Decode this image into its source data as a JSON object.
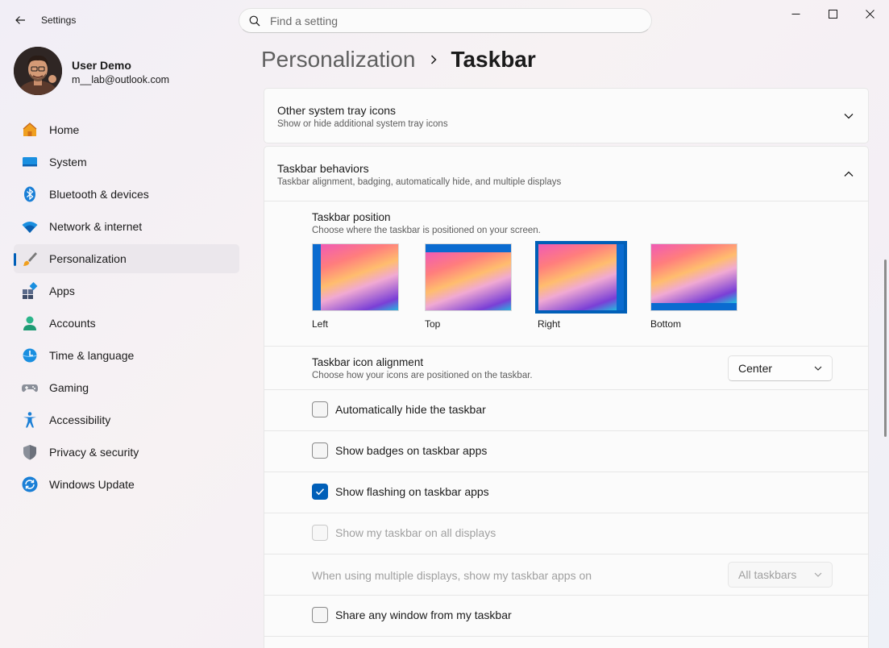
{
  "window": {
    "app_title": "Settings",
    "search_placeholder": "Find a setting"
  },
  "profile": {
    "name": "User Demo",
    "email": "m__lab@outlook.com"
  },
  "nav": {
    "items": [
      {
        "label": "Home",
        "icon": "home-icon"
      },
      {
        "label": "System",
        "icon": "system-icon"
      },
      {
        "label": "Bluetooth & devices",
        "icon": "bluetooth-icon"
      },
      {
        "label": "Network & internet",
        "icon": "wifi-icon"
      },
      {
        "label": "Personalization",
        "icon": "brush-icon",
        "active": true
      },
      {
        "label": "Apps",
        "icon": "apps-icon"
      },
      {
        "label": "Accounts",
        "icon": "accounts-icon"
      },
      {
        "label": "Time & language",
        "icon": "time-language-icon"
      },
      {
        "label": "Gaming",
        "icon": "gamepad-icon"
      },
      {
        "label": "Accessibility",
        "icon": "accessibility-icon"
      },
      {
        "label": "Privacy & security",
        "icon": "shield-icon"
      },
      {
        "label": "Windows Update",
        "icon": "update-icon"
      }
    ]
  },
  "breadcrumb": {
    "parent": "Personalization",
    "current": "Taskbar"
  },
  "tray_card": {
    "title": "Other system tray icons",
    "subtitle": "Show or hide additional system tray icons"
  },
  "behaviors_card": {
    "title": "Taskbar behaviors",
    "subtitle": "Taskbar alignment, badging, automatically hide, and multiple displays"
  },
  "position": {
    "title": "Taskbar position",
    "subtitle": "Choose where the taskbar is positioned on your screen.",
    "options": [
      "Left",
      "Top",
      "Right",
      "Bottom"
    ],
    "selected": "Right"
  },
  "alignment": {
    "title": "Taskbar icon alignment",
    "subtitle": "Choose how your icons are positioned on the taskbar.",
    "value": "Center"
  },
  "checks": {
    "auto_hide": {
      "label": "Automatically hide the taskbar",
      "checked": false
    },
    "badges": {
      "label": "Show badges on taskbar apps",
      "checked": false
    },
    "flashing": {
      "label": "Show flashing on taskbar apps",
      "checked": true
    },
    "all_displays": {
      "label": "Show my taskbar on all displays",
      "checked": false,
      "disabled": true
    },
    "share_window": {
      "label": "Share any window from my taskbar",
      "checked": false
    }
  },
  "multi_display": {
    "label": "When using multiple displays, show my taskbar apps on",
    "value": "All taskbars"
  },
  "colors": {
    "accent": "#005fb8",
    "taskbar_blue": "#0a6bd0"
  }
}
